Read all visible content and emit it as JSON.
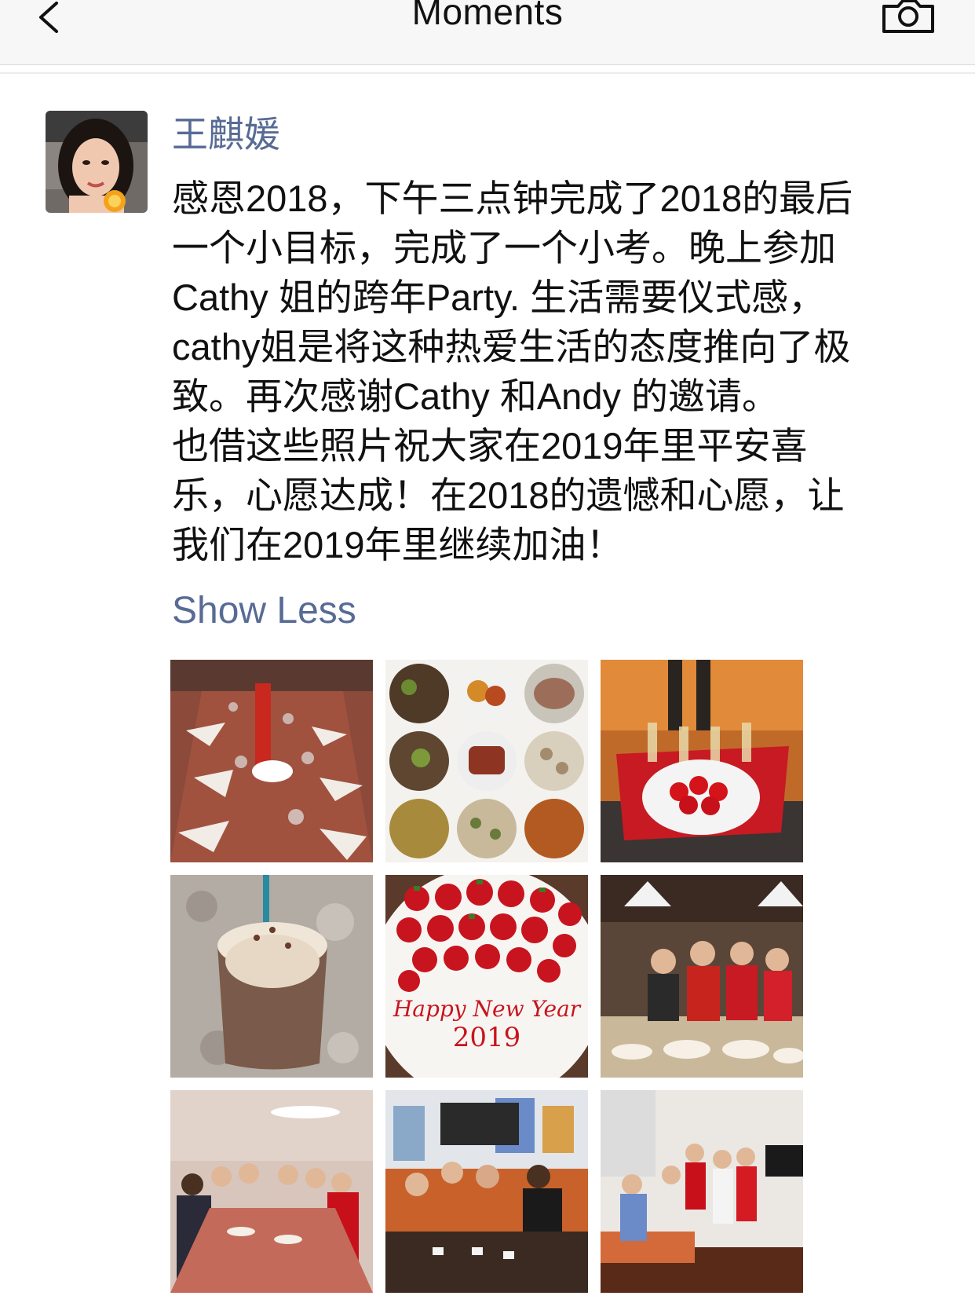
{
  "navbar": {
    "title": "Moments",
    "back_icon": "chevron-left-icon",
    "camera_icon": "camera-icon"
  },
  "post": {
    "author": "王麒媛",
    "text_lines": [
      "感恩2018，下午三点钟完成了2018的最后",
      "一个小目标，完成了一个小考。晚上参加",
      "Cathy 姐的跨年Party. 生活需要仪式感，",
      "cathy姐是将这种热爱生活的态度推向了极",
      "致。再次感谢Cathy 和Andy 的邀请。",
      "也借这些照片祝大家在2019年里平安喜",
      "乐，心愿达成！在2018的遗憾和心愿，让",
      "我们在2019年里继续加油！"
    ],
    "show_less": "Show Less",
    "photos": [
      {
        "name": "photo-dinner-table"
      },
      {
        "name": "photo-food-collage"
      },
      {
        "name": "photo-champagne-strawberries"
      },
      {
        "name": "photo-drink"
      },
      {
        "name": "photo-new-year-cake",
        "caption_line1": "Happy New Year",
        "caption_line2": "2019"
      },
      {
        "name": "photo-kitchen-group"
      },
      {
        "name": "photo-dinner-group"
      },
      {
        "name": "photo-card-game"
      },
      {
        "name": "photo-living-room-group"
      }
    ]
  },
  "colors": {
    "link": "#576b95",
    "text": "#111111",
    "navbar_bg": "#f7f7f7"
  }
}
